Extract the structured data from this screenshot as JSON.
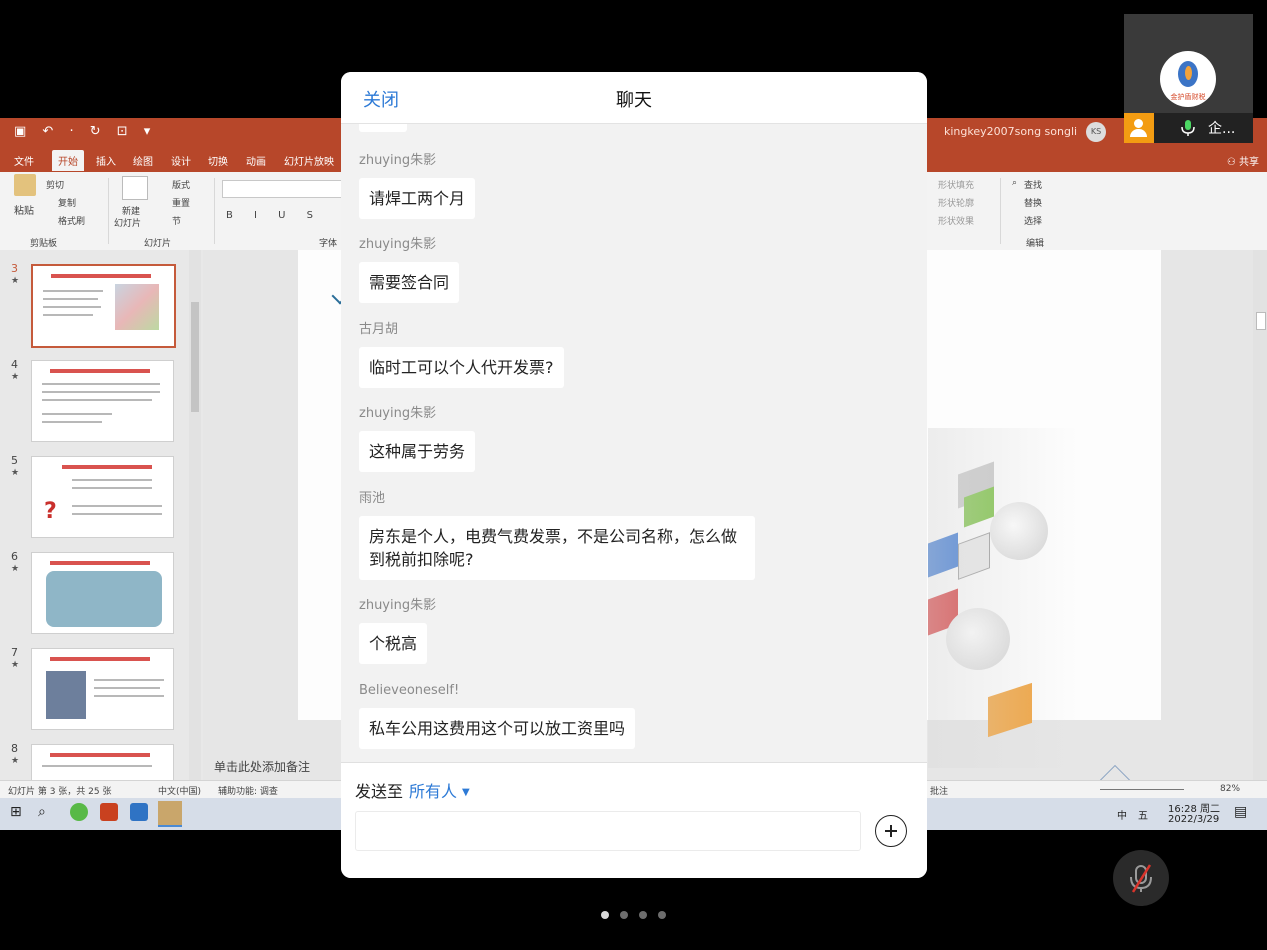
{
  "chat": {
    "title": "聊天",
    "close_label": "关闭",
    "messages": [
      {
        "sender": "zhuying朱影",
        "text": "请焊工两个月"
      },
      {
        "sender": "zhuying朱影",
        "text": "需要签合同"
      },
      {
        "sender": "古月胡",
        "text": "临时工可以个人代开发票?"
      },
      {
        "sender": "zhuying朱影",
        "text": "这种属于劳务"
      },
      {
        "sender": "雨池",
        "text": "房东是个人，电费气费发票，不是公司名称，怎么做到税前扣除呢?"
      },
      {
        "sender": "zhuying朱影",
        "text": "个税高"
      },
      {
        "sender": "Believeoneself!",
        "text": "私车公用这费用这个可以放工资里吗"
      }
    ],
    "send_to_label": "发送至",
    "recipient": "所有人",
    "input_placeholder": ""
  },
  "video_tile": {
    "name": "企...",
    "logo_caption": "金护盾财税"
  },
  "ppt": {
    "user": "kingkey2007song songli",
    "user_initials": "KS",
    "share_label": "共享",
    "tabs": [
      "文件",
      "开始",
      "插入",
      "绘图",
      "设计",
      "切换",
      "动画",
      "幻灯片放映"
    ],
    "active_tab": "开始",
    "ribbon": {
      "paste": "粘贴",
      "cut": "剪切",
      "copy": "复制",
      "format_painter": "格式刷",
      "clipboard_group": "剪贴板",
      "new_slide": "新建",
      "new_slide_2": "幻灯片",
      "layout": "版式",
      "reset": "重置",
      "section": "节",
      "slides_group": "幻灯片",
      "font_group": "字体",
      "shape_fill": "形状填充",
      "shape_outline": "形状轮廓",
      "shape_effect": "形状效果",
      "find": "查找",
      "replace": "替换",
      "select": "选择",
      "edit_group": "编辑"
    },
    "slide_numbers": [
      "3",
      "4",
      "5",
      "6",
      "7",
      "8"
    ],
    "notes_placeholder": "单击此处添加备注",
    "status": {
      "slide_info": "幻灯片 第 3 张，共 25 张",
      "language": "中文(中国)",
      "accessibility": "辅助功能: 调查",
      "comments": "批注",
      "zoom": "82%"
    },
    "taskbar": {
      "time": "16:28 周二",
      "date": "2022/3/29",
      "ime_1": "中",
      "ime_2": "五"
    }
  },
  "colors": {
    "accent_blue": "#2d7ad6",
    "ppt_red": "#b7472a",
    "tile_orange": "#f39c12"
  },
  "pager": {
    "count": 4,
    "active": 0
  }
}
